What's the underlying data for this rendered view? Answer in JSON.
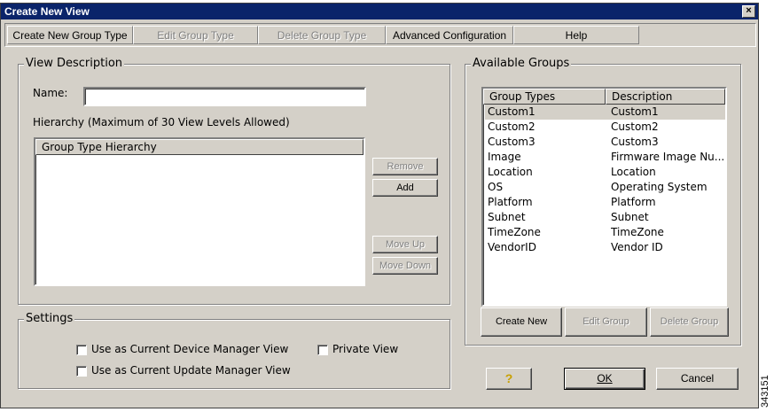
{
  "window": {
    "title": "Create New View",
    "close_glyph": "×"
  },
  "toolbar": {
    "create_group_type": "Create New Group Type",
    "edit_group_type": "Edit Group Type",
    "delete_group_type": "Delete Group Type",
    "advanced_configuration": "Advanced Configuration",
    "help": "Help"
  },
  "view_description": {
    "legend": "View Description",
    "name_label": "Name:",
    "name_value": "",
    "hierarchy_label": "Hierarchy (Maximum of 30 View Levels Allowed)",
    "hierarchy_header": "Group Type Hierarchy",
    "remove": "Remove",
    "add": "Add",
    "move_up": "Move Up",
    "move_down": "Move Down"
  },
  "available_groups": {
    "legend": "Available Groups",
    "columns": [
      "Group Types",
      "Description"
    ],
    "rows": [
      [
        "Custom1",
        "Custom1"
      ],
      [
        "Custom2",
        "Custom2"
      ],
      [
        "Custom3",
        "Custom3"
      ],
      [
        "Image",
        "Firmware Image Nu..."
      ],
      [
        "Location",
        "Location"
      ],
      [
        "OS",
        "Operating System"
      ],
      [
        "Platform",
        "Platform"
      ],
      [
        "Subnet",
        "Subnet"
      ],
      [
        "TimeZone",
        "TimeZone"
      ],
      [
        "VendorID",
        "Vendor ID"
      ]
    ],
    "selected_index": 0,
    "create_new": "Create New",
    "edit_group": "Edit Group",
    "delete_group": "Delete Group"
  },
  "settings": {
    "legend": "Settings",
    "device_manager": "Use as Current Device Manager View",
    "update_manager": "Use as Current Update Manager View",
    "private_view": "Private View"
  },
  "footer": {
    "help_glyph": "?",
    "ok": "OK",
    "cancel": "Cancel"
  },
  "figure_id": "343151"
}
